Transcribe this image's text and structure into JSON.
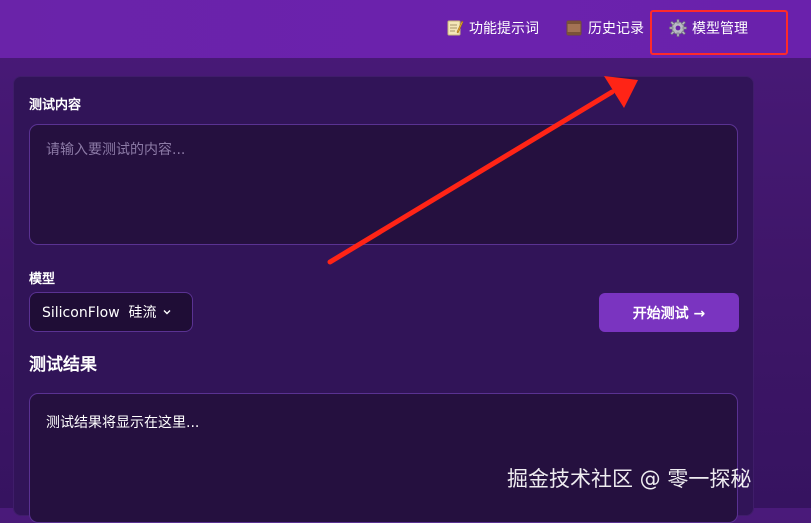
{
  "nav": {
    "prompts_label": "功能提示词",
    "history_label": "历史记录",
    "models_label": "模型管理"
  },
  "form": {
    "content_label": "测试内容",
    "content_placeholder": "请输入要测试的内容...",
    "model_label": "模型",
    "model_selected": "SiliconFlow  硅流",
    "start_button": "开始测试 →"
  },
  "result": {
    "heading": "测试结果",
    "placeholder": "测试结果将显示在这里..."
  },
  "watermark": "掘金技术社区 @ 零一探秘",
  "colors": {
    "topbar": "#6a23a9",
    "accent": "#7a34c0",
    "highlight": "#ff2a2a"
  }
}
